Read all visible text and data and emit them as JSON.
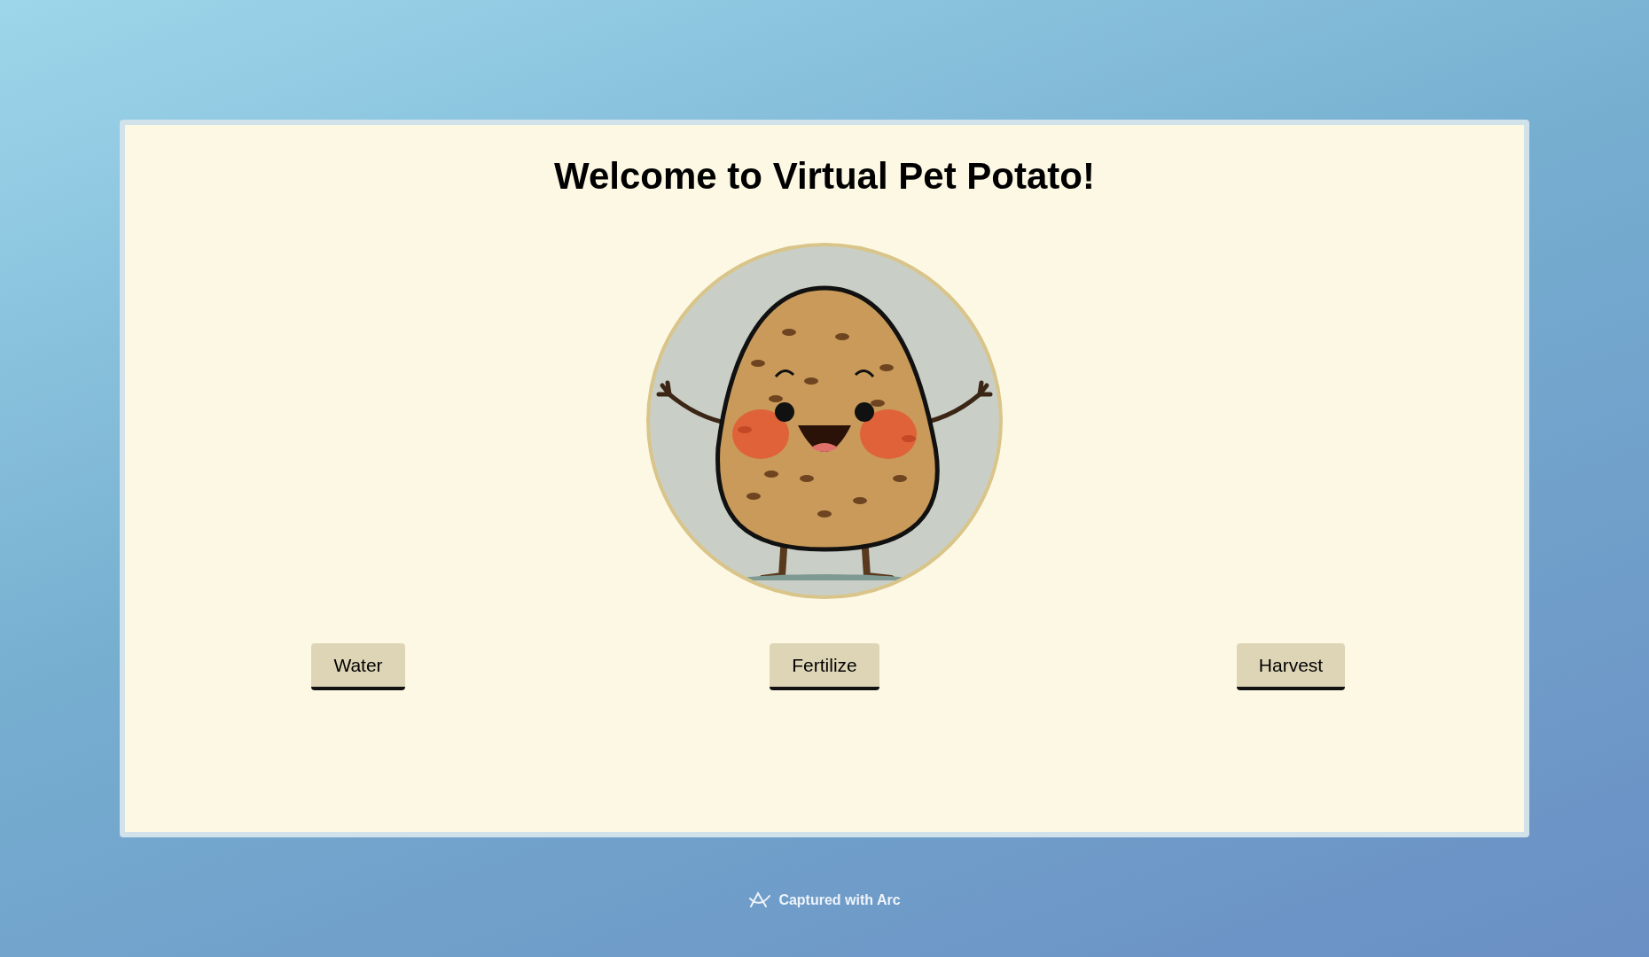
{
  "title": "Welcome to Virtual Pet Potato!",
  "buttons": [
    {
      "label": "Water"
    },
    {
      "label": "Fertilize"
    },
    {
      "label": "Harvest"
    }
  ],
  "footer": {
    "text": "Captured with Arc"
  }
}
